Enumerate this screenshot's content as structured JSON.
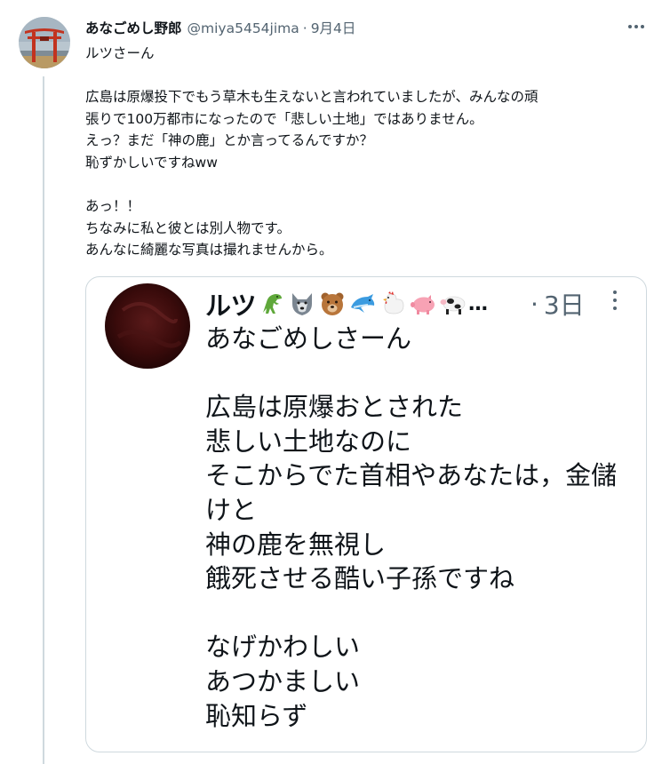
{
  "tweet": {
    "author_name": "あなごめし野郎",
    "handle": "@miya5454jima",
    "separator": "·",
    "date": "9月4日",
    "lines": [
      "ルツさーん",
      "",
      "広島は原爆投下でもう草木も生えないと言われていましたが、みんなの頑",
      "張りで100万都市になったので「悲しい土地」ではありません。",
      "えっ？まだ「神の鹿」とか言ってるんですか？",
      "恥ずかしいですねww",
      "",
      "あっ！！",
      "ちなみに私と彼とは別人物です。",
      "あんなに綺麗な写真は撮れませんから。"
    ]
  },
  "embedded": {
    "author_name": "ルツ",
    "emojis": [
      "t-rex-emoji",
      "wolf-emoji",
      "bear-emoji",
      "dolphin-emoji",
      "chicken-emoji",
      "pig-emoji",
      "cow-emoji"
    ],
    "ellipsis": "…",
    "separator": "·",
    "time": "3日",
    "lines": [
      "あなごめしさーん",
      "",
      "広島は原爆おとされた",
      "悲しい土地なのに",
      "そこからでた首相やあなたは，金儲",
      "けと",
      "神の鹿を無視し",
      "餓死させる酷い子孫ですね",
      "",
      "なげかわしい",
      "あつかましい",
      "恥知らず"
    ]
  }
}
